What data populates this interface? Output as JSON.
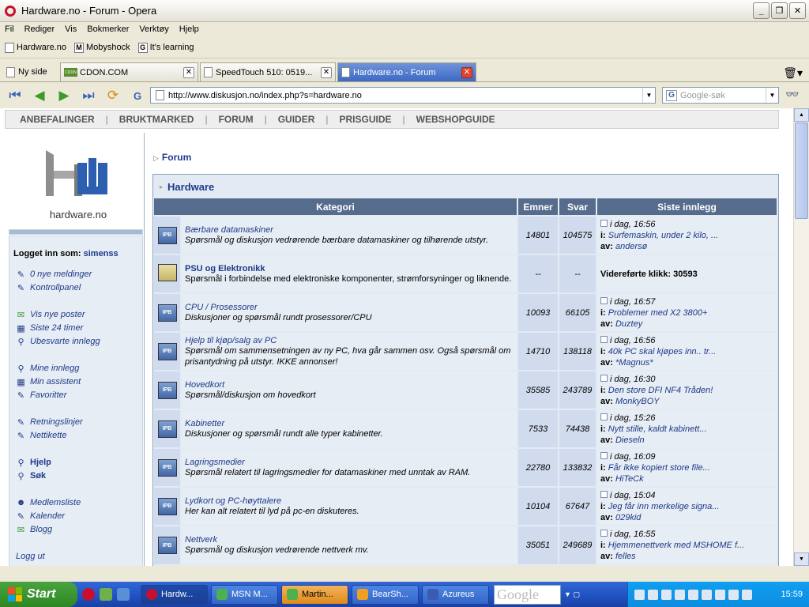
{
  "window": {
    "title": "Hardware.no - Forum - Opera"
  },
  "menu": [
    "Fil",
    "Rediger",
    "Vis",
    "Bokmerker",
    "Verktøy",
    "Hjelp"
  ],
  "bookmarks": [
    {
      "label": "Hardware.no",
      "icon": "page-icon"
    },
    {
      "label": "Mobyshock",
      "icon": "m-logo-icon"
    },
    {
      "label": "It's learning",
      "icon": "g-logo-icon"
    }
  ],
  "tabs": {
    "new_label": "Ny side",
    "items": [
      {
        "label": "CDON.COM"
      },
      {
        "label": "SpeedTouch 510:  0519..."
      },
      {
        "label": "Hardware.no - Forum"
      }
    ]
  },
  "address": {
    "url": "http://www.diskusjon.no/index.php?s=hardware.no",
    "search_placeholder": "Google-søk"
  },
  "sitenav": [
    "ANBEFALINGER",
    "BRUKTMARKED",
    "FORUM",
    "GUIDER",
    "PRISGUIDE",
    "WEBSHOPGUIDE"
  ],
  "logo": {
    "text": "hardware.no"
  },
  "sidebar": {
    "logged_in_label": "Logget inn som:",
    "user": "simenss",
    "items": [
      {
        "label": "0 nye meldinger"
      },
      {
        "label": "Kontrollpanel"
      },
      {
        "label": "Vis nye poster"
      },
      {
        "label": "Siste 24 timer"
      },
      {
        "label": "Ubesvarte innlegg"
      },
      {
        "label": "Mine innlegg"
      },
      {
        "label": "Min assistent"
      },
      {
        "label": "Favoritter"
      },
      {
        "label": "Retningslinjer"
      },
      {
        "label": "Nettikette"
      },
      {
        "label": "Hjelp"
      },
      {
        "label": "Søk"
      },
      {
        "label": "Medlemsliste"
      },
      {
        "label": "Kalender"
      },
      {
        "label": "Blogg"
      },
      {
        "label": "Logg ut"
      }
    ]
  },
  "breadcrumb": "Forum",
  "forum": {
    "section_title": "Hardware",
    "columns": [
      "Kategori",
      "Emner",
      "Svar",
      "Siste innlegg"
    ],
    "rows": [
      {
        "name": "Bærbare datamaskiner",
        "desc": "Spørsmål og diskusjon vedrørende bærbare datamaskiner og tilhørende utstyr.",
        "emner": "14801",
        "svar": "104575",
        "date": "i dag, 16:56",
        "post": "Surfemaskin, under 2 kilo, ...",
        "by": "andersø"
      },
      {
        "name": "PSU og Elektronikk",
        "desc": "Spørsmål i forbindelse med elektroniske komponenter, strømforsyninger og liknende.",
        "emner": "--",
        "svar": "--",
        "redirect": "Videreførte klikk: 30593"
      },
      {
        "name": "CPU / Prosessorer",
        "desc": "Diskusjoner og spørsmål rundt prosessorer/CPU",
        "emner": "10093",
        "svar": "66105",
        "date": "i dag, 16:57",
        "post": "Problemer med X2 3800+",
        "by": "Duztey"
      },
      {
        "name": "Hjelp til kjøp/salg av PC",
        "desc": "Spørsmål om sammensetningen av ny PC, hva går sammen osv. Også spørsmål om prisantydning på utstyr. IKKE annonser!",
        "emner": "14710",
        "svar": "138118",
        "date": "i dag, 16:56",
        "post": "40k PC skal kjøpes inn.. tr...",
        "by": "*Magnus*"
      },
      {
        "name": "Hovedkort",
        "desc": "Spørsmål/diskusjon om hovedkort",
        "emner": "35585",
        "svar": "243789",
        "date": "i dag, 16:30",
        "post": "Den store DFI NF4 Tråden!",
        "by": "MonkyBOY"
      },
      {
        "name": "Kabinetter",
        "desc": "Diskusjoner og spørsmål rundt alle typer kabinetter.",
        "emner": "7533",
        "svar": "74438",
        "date": "i dag, 15:26",
        "post": "Nytt stille, kaldt kabinett...",
        "by": "Dieseln"
      },
      {
        "name": "Lagringsmedier",
        "desc": "Spørsmål relatert til lagringsmedier for datamaskiner med unntak av RAM.",
        "emner": "22780",
        "svar": "133832",
        "date": "i dag, 16:09",
        "post": "Får ikke kopiert store file...",
        "by": "HiTeCk"
      },
      {
        "name": "Lydkort og PC-høyttalere",
        "desc": "Her kan alt relatert til lyd på pc-en diskuteres.",
        "emner": "10104",
        "svar": "67647",
        "date": "i dag, 15:04",
        "post": "Jeg får inn merkelige signa...",
        "by": "029kid"
      },
      {
        "name": "Nettverk",
        "desc": "Spørsmål og diskusjon vedrørende nettverk mv.",
        "emner": "35051",
        "svar": "249689",
        "date": "i dag, 16:55",
        "post": "Hjemmenettverk med MSHOME f...",
        "by": "felles"
      }
    ],
    "labels": {
      "post_prefix": "i:",
      "by_prefix": "av:"
    }
  },
  "taskbar": {
    "start": "Start",
    "buttons": [
      {
        "label": "Hardw..."
      },
      {
        "label": "MSN M..."
      },
      {
        "label": "Martin..."
      },
      {
        "label": "BearSh..."
      },
      {
        "label": "Azureus"
      }
    ],
    "google": "Google",
    "clock": "15:59"
  },
  "colors": {
    "accent": "#1e3a8a",
    "header_bg": "#566c8d",
    "row_light": "#e7edf4",
    "row_dark": "#d0dced"
  }
}
